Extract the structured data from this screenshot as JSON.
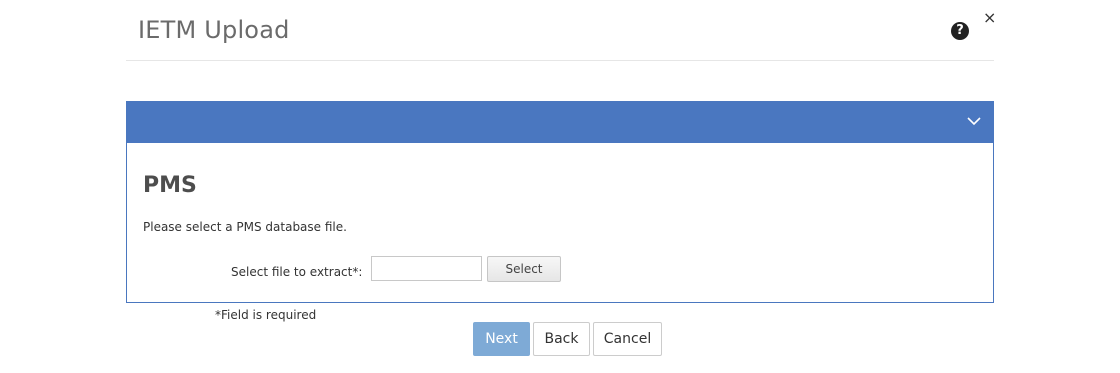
{
  "dialog": {
    "title": "IETM Upload",
    "help_icon": "question-circle-icon",
    "close_symbol": "×"
  },
  "panel": {
    "header_color": "#4a77c0",
    "expand_icon": "chevron-down-icon",
    "section_title": "PMS",
    "instructions": "Please select a PMS database file.",
    "field_label": "Select file to extract*:",
    "file_value": "",
    "select_label": "Select"
  },
  "required_note": "*Field is required",
  "footer": {
    "next_label": "Next",
    "back_label": "Back",
    "cancel_label": "Cancel",
    "primary_color": "#7eaad6"
  }
}
